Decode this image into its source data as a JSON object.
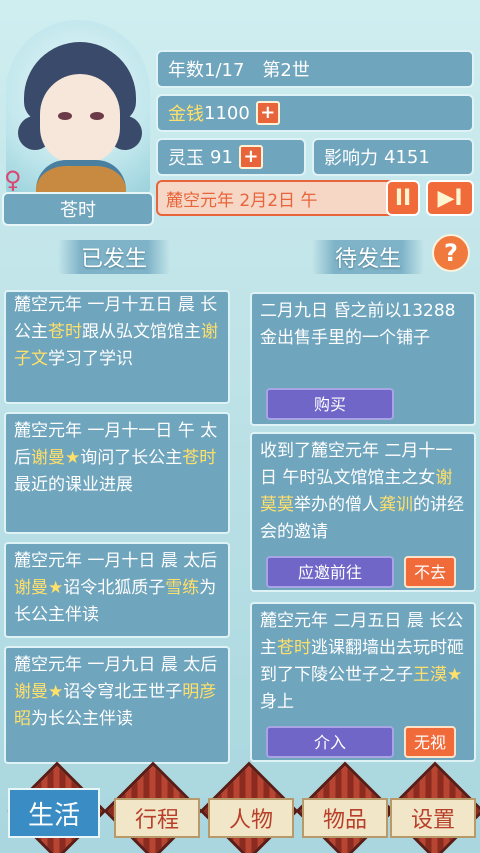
{
  "character": {
    "name": "苍时",
    "gender_icon": "female-icon"
  },
  "stats": {
    "year_label": "年数1/17",
    "generation": "第2世",
    "money_label": "金钱",
    "money_value": "1100",
    "jade_label": "灵玉",
    "jade_value": "91",
    "influence_label": "影响力",
    "influence_value": "4151",
    "plus": "+"
  },
  "date": {
    "text": "麓空元年 2月2日 午",
    "pause_icon": "pause-icon",
    "skip_icon": "skip-forward-icon",
    "pause_glyph": "II",
    "skip_glyph": "▶I"
  },
  "sections": {
    "happened": "已发生",
    "pending": "待发生",
    "help": "?"
  },
  "happened_events": [
    {
      "parts": [
        "麓空元年 一月十五日 晨 长公主",
        "苍时",
        "跟从弘文馆馆主",
        "谢子文",
        "学习了学识"
      ]
    },
    {
      "parts": [
        "麓空元年 一月十一日 午 太后",
        "谢曼★",
        "询问了长公主",
        "苍时",
        "最近的课业进展"
      ]
    },
    {
      "parts": [
        "麓空元年 一月十日 晨 太后",
        "谢曼★",
        "诏令北狐质子",
        "雪练",
        "为长公主伴读"
      ]
    },
    {
      "parts": [
        "麓空元年 一月九日 晨 太后",
        "谢曼★",
        "诏令穹北王世子",
        "明彦昭",
        "为长公主伴读"
      ]
    }
  ],
  "pending_events": [
    {
      "parts": [
        "二月九日 昏之前以13288金出售手里的一个铺子"
      ],
      "buttons": [
        "购买"
      ]
    },
    {
      "parts": [
        "收到了麓空元年 二月十一日 午时弘文馆馆主之女",
        "谢莫莫",
        "举办的僧人",
        "龚训",
        "的讲经会的邀请"
      ],
      "buttons": [
        "应邀前往",
        "不去"
      ]
    },
    {
      "parts": [
        "麓空元年 二月五日 晨 长公主",
        "苍时",
        "逃课翻墙出去玩时砸到了下陵公世子之子",
        "王漠★",
        "身上"
      ],
      "buttons": [
        "介入",
        "无视"
      ]
    }
  ],
  "nav": [
    "生活",
    "行程",
    "人物",
    "物品",
    "设置"
  ],
  "colors": {
    "panel": "#6fa5bd",
    "highlight": "#ffe06a",
    "accent": "#f06a3a",
    "action": "#6f66c8"
  }
}
